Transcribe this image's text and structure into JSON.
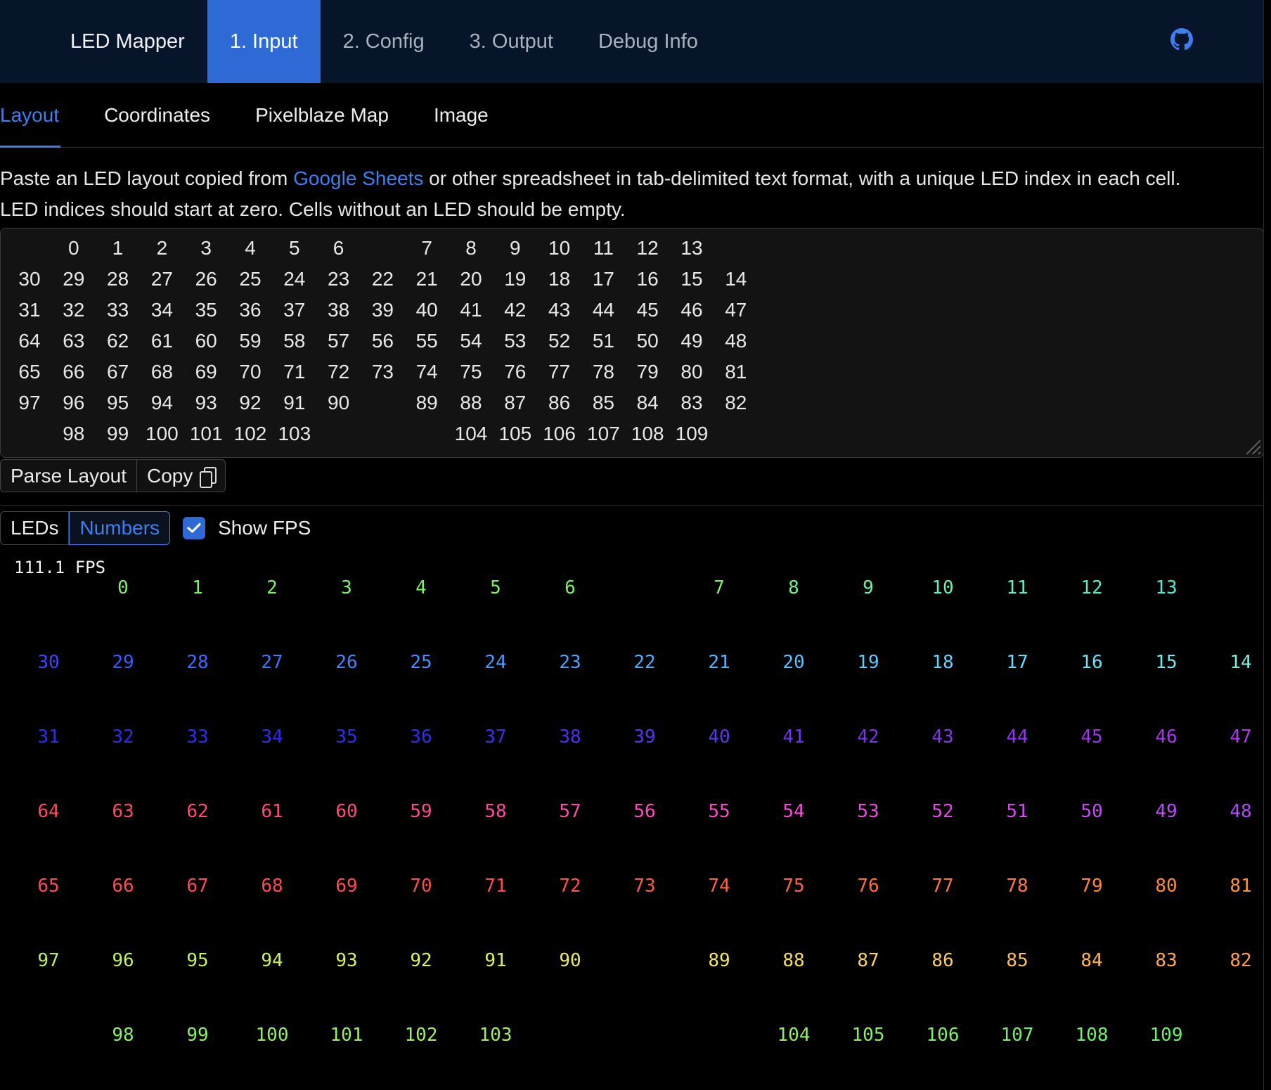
{
  "navbar": {
    "brand": "LED Mapper",
    "items": [
      {
        "label": "1. Input",
        "active": true
      },
      {
        "label": "2. Config",
        "active": false
      },
      {
        "label": "3. Output",
        "active": false
      },
      {
        "label": "Debug Info",
        "active": false
      }
    ],
    "github_icon": "github-icon"
  },
  "subtabs": [
    {
      "label": "Layout",
      "active": true
    },
    {
      "label": "Coordinates",
      "active": false
    },
    {
      "label": "Pixelblaze Map",
      "active": false
    },
    {
      "label": "Image",
      "active": false
    }
  ],
  "description": {
    "before_link": "Paste an LED layout copied from ",
    "link": "Google Sheets",
    "after_link": " or other spreadsheet in tab-delimited text format, with a unique LED index in each cell.",
    "line2": "LED indices should start at zero. Cells without an LED should be empty."
  },
  "layout_rows": [
    [
      "",
      "0",
      "1",
      "2",
      "3",
      "4",
      "5",
      "6",
      "",
      "7",
      "8",
      "9",
      "10",
      "11",
      "12",
      "13",
      ""
    ],
    [
      "30",
      "29",
      "28",
      "27",
      "26",
      "25",
      "24",
      "23",
      "22",
      "21",
      "20",
      "19",
      "18",
      "17",
      "16",
      "15",
      "14"
    ],
    [
      "31",
      "32",
      "33",
      "34",
      "35",
      "36",
      "37",
      "38",
      "39",
      "40",
      "41",
      "42",
      "43",
      "44",
      "45",
      "46",
      "47"
    ],
    [
      "64",
      "63",
      "62",
      "61",
      "60",
      "59",
      "58",
      "57",
      "56",
      "55",
      "54",
      "53",
      "52",
      "51",
      "50",
      "49",
      "48"
    ],
    [
      "65",
      "66",
      "67",
      "68",
      "69",
      "70",
      "71",
      "72",
      "73",
      "74",
      "75",
      "76",
      "77",
      "78",
      "79",
      "80",
      "81"
    ],
    [
      "97",
      "96",
      "95",
      "94",
      "93",
      "92",
      "91",
      "90",
      "",
      "89",
      "88",
      "87",
      "86",
      "85",
      "84",
      "83",
      "82"
    ],
    [
      "",
      "98",
      "99",
      "100",
      "101",
      "102",
      "103",
      "",
      "",
      "",
      "104",
      "105",
      "106",
      "107",
      "108",
      "109",
      ""
    ]
  ],
  "buttons": {
    "parse": "Parse Layout",
    "copy": "Copy",
    "copy_icon": "copy-icon"
  },
  "display_toggle": {
    "leds": "LEDs",
    "numbers": "Numbers",
    "selected": "Numbers"
  },
  "show_fps": {
    "label": "Show FPS",
    "checked": true
  },
  "fps_readout": "111.1 FPS",
  "row_colors": [
    [
      "#7ff06a",
      "#7ff06a",
      "#7ff06a",
      "#7ff06a",
      "#7ff06a",
      "#7ff06a",
      "#7ff06a",
      "#7ff06a",
      "#7ff06a",
      "#7ff070",
      "#79f285",
      "#6ef49e",
      "#66f2ae",
      "#5ff0be",
      "#59eccb",
      "#55e8d6",
      "#55e8d6"
    ],
    [
      "#3a44ff",
      "#3a5cff",
      "#3c6cff",
      "#3f78ff",
      "#4184ff",
      "#448eff",
      "#479aff",
      "#4aa4ff",
      "#4eaeff",
      "#53b8ff",
      "#58c2ff",
      "#5ccaff",
      "#62d2ff",
      "#67daff",
      "#6ee2fa",
      "#76e8ef",
      "#7ceee2"
    ],
    [
      "#2f2cf0",
      "#2f2cf0",
      "#2f2cf0",
      "#2f2cf0",
      "#2f2cf0",
      "#2f2cf0",
      "#3a30f0",
      "#4a32f0",
      "#5634f0",
      "#6234f0",
      "#6e34f0",
      "#7a34f0",
      "#8634f0",
      "#9234f0",
      "#9e34f0",
      "#aa34f0",
      "#b634f0"
    ],
    [
      "#ff4a5a",
      "#ff4a64",
      "#ff4a6e",
      "#ff4a7a",
      "#ff4a86",
      "#ff4a92",
      "#ff4aa0",
      "#ff4aae",
      "#ff4abc",
      "#ff4ac8",
      "#f64ad4",
      "#ec4ade",
      "#e24ae8",
      "#d64af0",
      "#c84af6",
      "#ba4afa",
      "#ad4afc"
    ],
    [
      "#ff4a52",
      "#ff4a50",
      "#ff4a4e",
      "#ff4a4c",
      "#ff4a4a",
      "#ff4a48",
      "#ff4c46",
      "#ff5244",
      "#ff5842",
      "#ff5e40",
      "#ff643e",
      "#ff6c3c",
      "#ff743a",
      "#ff7c38",
      "#ff8436",
      "#ff8c34",
      "#ff9432"
    ],
    [
      "#b6f25a",
      "#bef25a",
      "#c6f25a",
      "#cef25a",
      "#d6f25a",
      "#def25a",
      "#e4f05a",
      "#ecee5a",
      "#f2ec5a",
      "#f6e65a",
      "#f8de5a",
      "#fad65a",
      "#fccc58",
      "#fdc256",
      "#feb654",
      "#ffaa52",
      "#ff9e50"
    ],
    [
      "#7ff06a",
      "#86f066",
      "#8cf064",
      "#92f062",
      "#98f060",
      "#9ef05e",
      "#9ef05e",
      "#9ef05e",
      "#9ef05e",
      "#9ef05e",
      "#8ef060",
      "#86f062",
      "#7ef064",
      "#76f066",
      "#6ef068",
      "#6ef068",
      "#6ef068"
    ]
  ]
}
